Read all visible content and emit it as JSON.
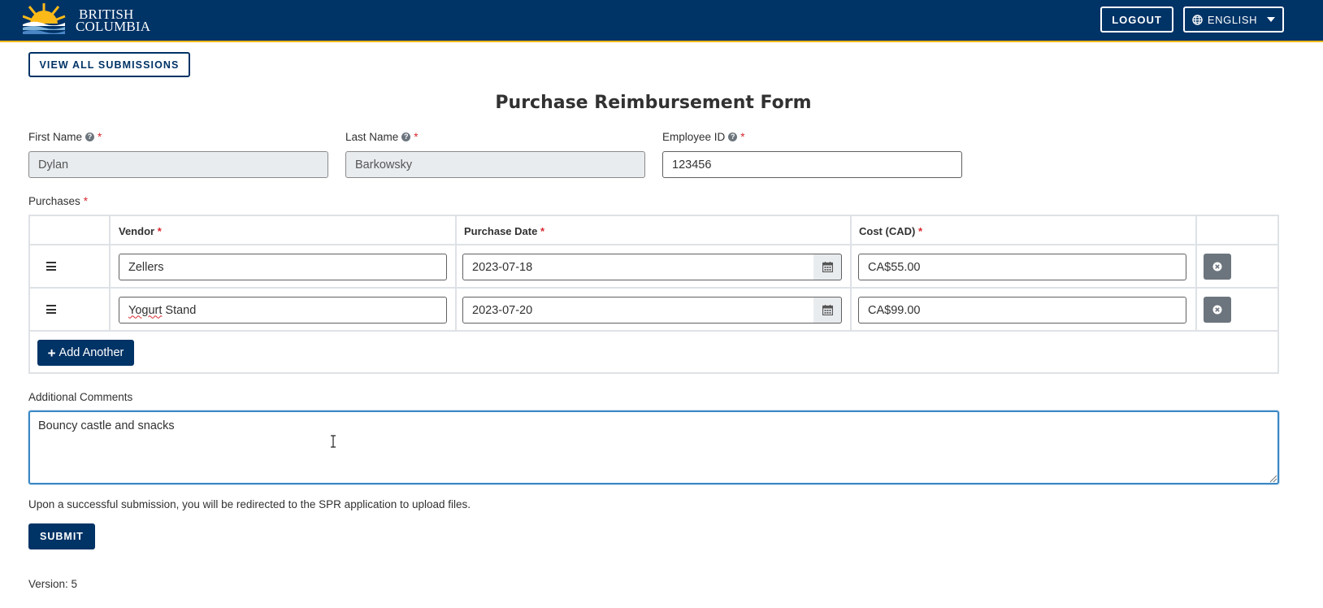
{
  "header": {
    "logo": {
      "line1": "BRITISH",
      "line2": "COLUMBIA"
    },
    "logout_label": "LOGOUT",
    "language_label": "ENGLISH",
    "language_icon": "globe-icon"
  },
  "toolbar": {
    "view_all_label": "VIEW ALL SUBMISSIONS"
  },
  "form": {
    "title": "Purchase Reimbursement Form",
    "required_marker": "*",
    "fields": {
      "first_name": {
        "label": "First Name",
        "value": "Dylan",
        "disabled": true
      },
      "last_name": {
        "label": "Last Name",
        "value": "Barkowsky",
        "disabled": true
      },
      "employee_id": {
        "label": "Employee ID",
        "value": "123456",
        "disabled": false
      }
    },
    "purchases": {
      "label": "Purchases",
      "columns": [
        "Vendor",
        "Purchase Date",
        "Cost (CAD)"
      ],
      "rows": [
        {
          "vendor": "Zellers",
          "date": "2023-07-18",
          "cost": "CA$55.00"
        },
        {
          "vendor_pre": "",
          "vendor_flagged": "Yogurt",
          "vendor_post": " Stand",
          "date": "2023-07-20",
          "cost": "CA$99.00"
        }
      ],
      "add_label": "Add Another",
      "add_icon": "plus-icon"
    },
    "comments": {
      "label": "Additional Comments",
      "value": "Bouncy castle and snacks"
    },
    "note": "Upon a successful submission, you will be redirected to the SPR application to upload files.",
    "submit_label": "SUBMIT",
    "version": "Version: 5"
  },
  "colors": {
    "brand_navy": "#003366",
    "brand_gold": "#fcba19",
    "required_red": "#d8292f",
    "focus_blue": "#3b88c3",
    "secondary_gray": "#6c757d"
  }
}
